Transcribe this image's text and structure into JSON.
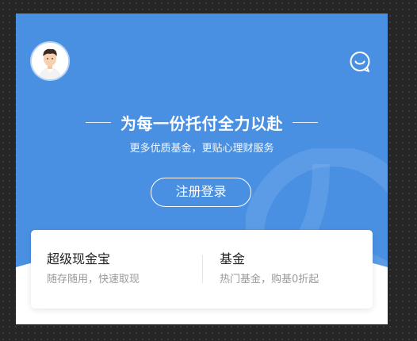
{
  "hero": {
    "title": "为每一份托付全力以赴",
    "subtitle": "更多优质基金，更贴心理财服务",
    "register_label": "注册登录"
  },
  "icons": {
    "avatar": "avatar-icon",
    "service": "customer-service-icon",
    "watermark": "brand-logo-watermark"
  },
  "products": [
    {
      "name": "超级现金宝",
      "desc": "随存随用，快速取现"
    },
    {
      "name": "基金",
      "desc": "热门基金，购基0折起"
    }
  ],
  "colors": {
    "hero_bg": "#4a90e2",
    "card_bg": "#ffffff",
    "page_bg": "#262626"
  }
}
